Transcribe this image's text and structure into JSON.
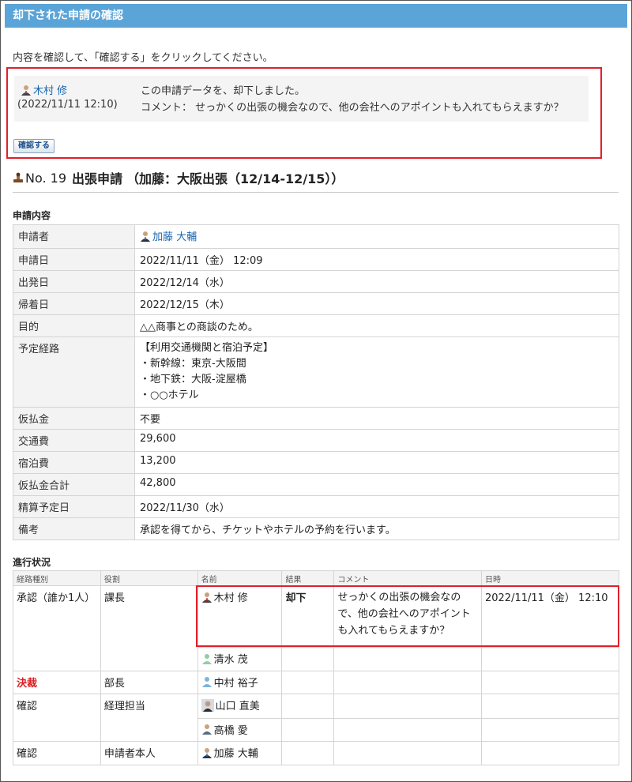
{
  "window": {
    "title": "却下された申請の確認"
  },
  "instruction": "内容を確認して、「確認する」をクリックしてください。",
  "notice": {
    "user": "木村 修",
    "time": "(2022/11/11 12:10)",
    "message": "この申請データを、却下しました。",
    "comment": "コメント： せっかくの出張の機会なので、他の会社へのアポイントも入れてもらえますか？",
    "confirm_button": "確認する"
  },
  "application": {
    "number": "No. 19",
    "type": "出張申請",
    "subject": "（加藤：大阪出張（12/14-12/15））"
  },
  "details": {
    "section_title": "申請内容",
    "rows": [
      {
        "label": "申請者",
        "value": "加藤 大輔",
        "kind": "user"
      },
      {
        "label": "申請日",
        "value": "2022/11/11（金） 12:09"
      },
      {
        "label": "出発日",
        "value": "2022/12/14（水）"
      },
      {
        "label": "帰着日",
        "value": "2022/12/15（木）"
      },
      {
        "label": "目的",
        "value": "△△商事との商談のため。"
      },
      {
        "label": "予定経路",
        "lines": [
          "【利用交通機関と宿泊予定】",
          "・新幹線：東京-大阪間",
          "・地下鉄：大阪-淀屋橋",
          "・○○ホテル"
        ]
      },
      {
        "label": "仮払金",
        "value": "不要"
      },
      {
        "label": "交通費",
        "value": "29,600"
      },
      {
        "label": "宿泊費",
        "value": "13,200"
      },
      {
        "label": "仮払金合計",
        "value": "42,800"
      },
      {
        "label": "精算予定日",
        "value": "2022/11/30（水）"
      },
      {
        "label": "備考",
        "value": "承認を得てから、チケットやホテルの予約を行います。"
      }
    ]
  },
  "progress": {
    "section_title": "進行状況",
    "headers": [
      "経路種別",
      "役割",
      "名前",
      "結果",
      "コメント",
      "日時"
    ],
    "rows": [
      {
        "route": "承認（誰か1人）",
        "role": "課長",
        "name": "木村 修",
        "result": "却下",
        "comment": "せっかくの出張の機会なので、他の会社へのアポイントも入れてもらえますか？",
        "datetime": "2022/11/11（金） 12:10"
      },
      {
        "name": "清水 茂"
      },
      {
        "route": "決裁",
        "role": "部長",
        "name": "中村 裕子"
      },
      {
        "route": "確認",
        "role": "経理担当",
        "name": "山口 直美"
      },
      {
        "name": "高橋 愛"
      },
      {
        "route": "確認",
        "role": "申請者本人",
        "name": "加藤 大輔"
      }
    ]
  },
  "colors": {
    "title_bar": "#5aa4d8",
    "highlight": "#e0202a",
    "rejected": "#c0300e",
    "link": "#1a66b0"
  }
}
